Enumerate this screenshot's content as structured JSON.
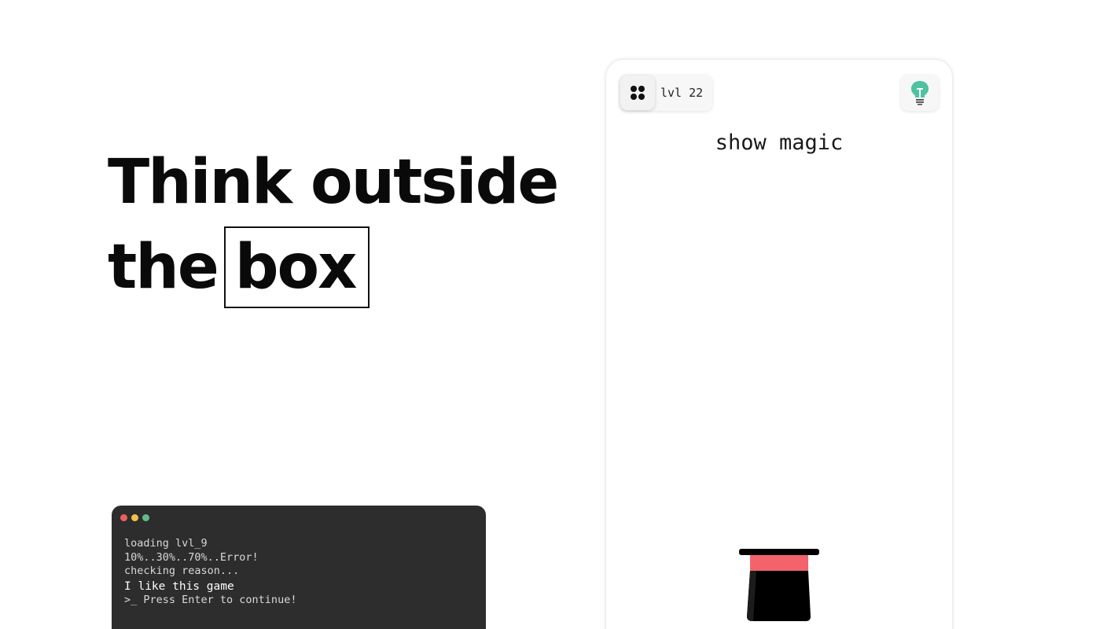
{
  "headline": {
    "line1": "Think outside",
    "line2_prefix": "the",
    "boxed_word": "box"
  },
  "terminal": {
    "dot_colors": [
      "#ee5f5b",
      "#f5c04a",
      "#62b98c"
    ],
    "lines": [
      "loading lvl_9",
      "10%..30%..70%..Error!",
      "checking reason...",
      "I like this game",
      ">_ Press Enter to continue!"
    ]
  },
  "game": {
    "level_label": "lvl 22",
    "title": "show magic",
    "menu_icon": "grid-dots-icon",
    "hint_icon": "lightbulb-icon",
    "hint_color": "#4fc3a1",
    "hat_band_color": "#f2636b",
    "hat_color": "#000000"
  }
}
